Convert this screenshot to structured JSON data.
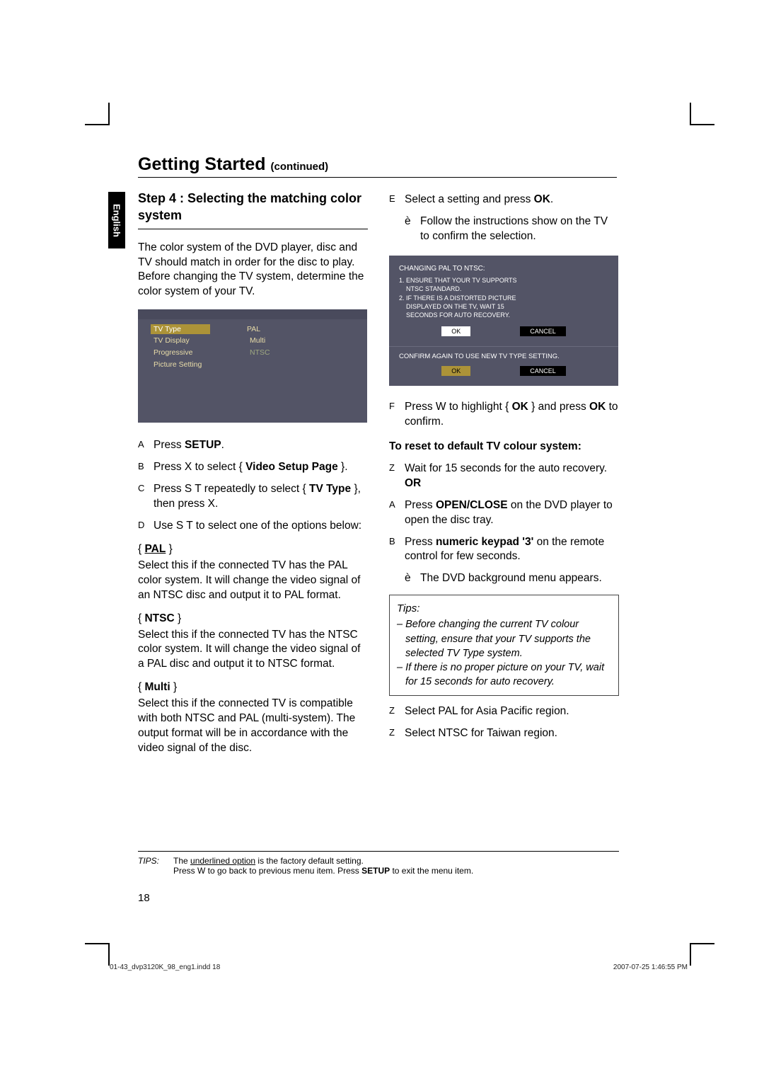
{
  "header": {
    "title": "Getting Started",
    "continued": "(continued)"
  },
  "langTab": "English",
  "left": {
    "stepHeading": "Step 4 :  Selecting the matching color system",
    "intro": "The color system of the DVD player, disc and TV should match in order for the disc to play. Before changing the TV system, determine the color system of your TV.",
    "osd": {
      "r1l": "TV Type",
      "r1v": "PAL",
      "r2l": "TV Display",
      "r2v": "Multi",
      "r3l": "Progressive",
      "r3v": "NTSC",
      "r4l": "Picture Setting"
    },
    "steps": {
      "A": "Press ",
      "A_b": "SETUP",
      "A_end": ".",
      "B": "Press  X to select { ",
      "B_b": "Video Setup Page",
      "B_end": " }.",
      "C": "Press  S  T repeatedly to select { ",
      "C_b": "TV Type",
      "C_end": " }, then press  X.",
      "D": "Use  S  T to select one of the options below:"
    },
    "pal": {
      "head": "PAL",
      "body": "Select this if the connected TV has the PAL color system. It will change the video signal of an NTSC disc and output it to PAL format."
    },
    "ntsc": {
      "head": "NTSC",
      "body": "Select this if the connected TV has the NTSC color system. It will change the video signal of a PAL disc and output it to NTSC format."
    },
    "multi": {
      "head": "Multi",
      "body": "Select this if the connected TV is compatible with both NTSC and PAL (multi-system). The output format will be in accordance with the video signal of the disc."
    }
  },
  "right": {
    "E": "Select a setting and press ",
    "E_b": "OK",
    "E_end": ".",
    "E_sub": "Follow the instructions show on the TV to confirm the selection.",
    "tv": {
      "title": "CHANGING PAL TO NTSC:",
      "l1": "1. ENSURE THAT YOUR TV SUPPORTS",
      "l1b": "NTSC STANDARD.",
      "l2": "2. IF THERE IS A DISTORTED PICTURE",
      "l2b": "DISPLAYED ON THE TV, WAIT 15",
      "l2c": "SECONDS FOR AUTO RECOVERY.",
      "ok": "OK",
      "cancel": "CANCEL",
      "confirm": "CONFIRM AGAIN TO USE NEW TV TYPE SETTING."
    },
    "F": "Press  W to highlight { ",
    "F_b": "OK",
    "F_end": " } and press ",
    "F_b2": "OK",
    "F_end2": " to confirm.",
    "resetHead": "To reset to default TV colour system:",
    "Z1": "Wait for 15 seconds for the auto recovery.",
    "OR": "OR",
    "A2_pre": "Press ",
    "A2_b": "OPEN/CLOSE",
    "A2_post": "        on the DVD player to open the disc tray.",
    "B2_pre": "Press ",
    "B2_b": "numeric keypad '3'",
    "B2_post": " on the remote control for few seconds.",
    "B2_sub": "The DVD background menu appears.",
    "tips": {
      "head": "Tips:",
      "p1": "– Before changing the current TV colour setting, ensure that your TV supports the selected TV Type  system.",
      "p2": "– If there is no proper picture on your TV, wait for 15 seconds for auto recovery."
    },
    "Z2": "Select PAL for Asia Pacific region.",
    "Z3": "Select NTSC for Taiwan region."
  },
  "footer": {
    "label": "TIPS:",
    "line1a": "The ",
    "line1u": "underlined option",
    "line1b": " is the factory default setting.",
    "line2a": "Press  W to go back to previous menu item. Press ",
    "line2b": "SETUP",
    "line2c": " to exit the menu item."
  },
  "pageNum": "18",
  "imprintLeft": "01-43_dvp3120K_98_eng1.indd   18",
  "imprintRight": "2007-07-25   1:46:55 PM"
}
